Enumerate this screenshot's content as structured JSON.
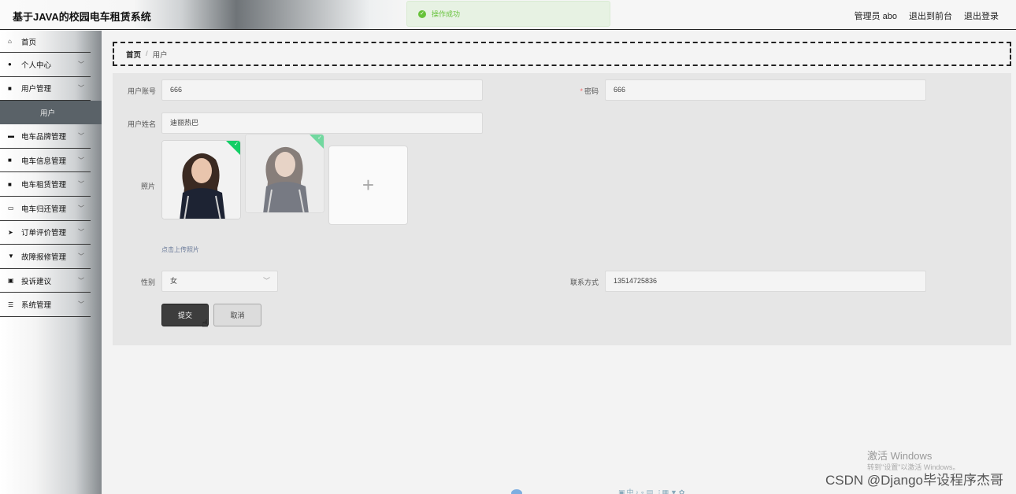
{
  "header": {
    "title": "基于JAVA的校园电车租赁系统",
    "toast": "操作成功",
    "user": "管理员 abo",
    "to_front": "退出到前台",
    "logout": "退出登录"
  },
  "sidebar": {
    "items": [
      {
        "label": "首页",
        "icon": "home-icon"
      },
      {
        "label": "个人中心",
        "icon": "user-icon"
      },
      {
        "label": "用户管理",
        "icon": "grid-icon"
      },
      {
        "label": "用户",
        "sub": true
      },
      {
        "label": "电车品牌管理",
        "icon": "car-icon"
      },
      {
        "label": "电车信息管理",
        "icon": "grid-icon"
      },
      {
        "label": "电车租赁管理",
        "icon": "grid-icon"
      },
      {
        "label": "电车归还管理",
        "icon": "monitor-icon"
      },
      {
        "label": "订单评价管理",
        "icon": "send-icon"
      },
      {
        "label": "故障报修管理",
        "icon": "trophy-icon"
      },
      {
        "label": "投诉建议",
        "icon": "clipboard-icon"
      },
      {
        "label": "系统管理",
        "icon": "list-icon"
      }
    ]
  },
  "breadcrumb": {
    "home": "首页",
    "sep": "/",
    "current": "用户"
  },
  "form": {
    "account_label": "用户账号",
    "account_value": "666",
    "password_label": "密码",
    "password_required": "*",
    "password_value": "666",
    "name_label": "用户姓名",
    "name_value": "迪丽热巴",
    "photo_label": "照片",
    "upload_hint": "点击上传照片",
    "upload_plus": "+",
    "gender_label": "性别",
    "gender_value": "女",
    "contact_label": "联系方式",
    "contact_value": "13514725836",
    "submit": "提交",
    "cancel": "取消"
  },
  "overlay": {
    "win_activate": "激活 Windows",
    "win_activate_sub": "转到\"设置\"以激活 Windows。",
    "csdn": "CSDN @Django毕设程序杰哥"
  },
  "colors": {
    "success": "#67c23a",
    "check": "#13ce66",
    "dark_button": "#3d3d3d",
    "required": "#f56c6c"
  }
}
